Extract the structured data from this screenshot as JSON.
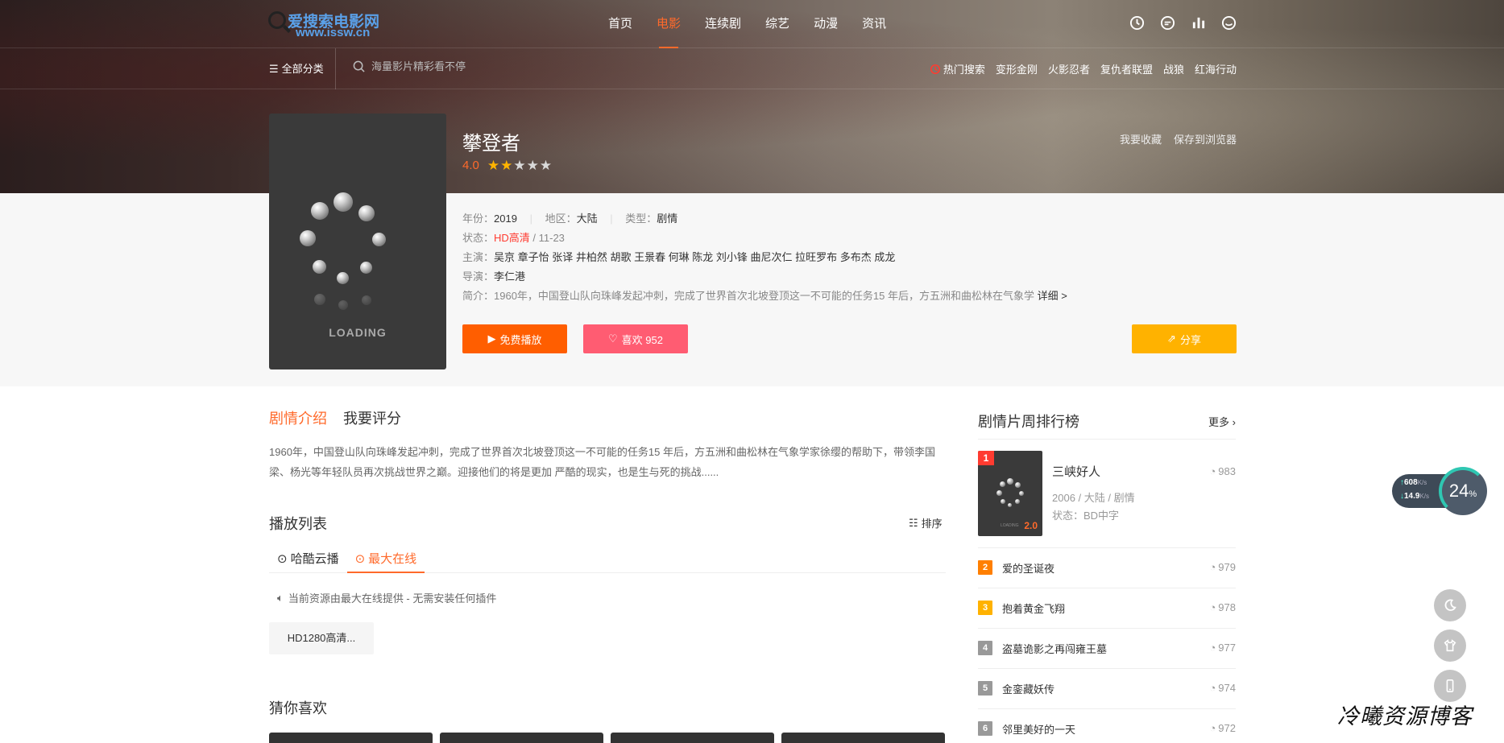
{
  "logo": {
    "line1": "爱搜索电影网",
    "line2": "www.issw.cn"
  },
  "nav": {
    "items": [
      {
        "label": "首页",
        "active": false
      },
      {
        "label": "电影",
        "active": true
      },
      {
        "label": "连续剧",
        "active": false
      },
      {
        "label": "综艺",
        "active": false
      },
      {
        "label": "动漫",
        "active": false
      },
      {
        "label": "资讯",
        "active": false
      }
    ],
    "icons": [
      "clock-icon",
      "message-icon",
      "chart-bar-icon",
      "user-smile-icon"
    ]
  },
  "subnav": {
    "all_categories": "全部分类",
    "search_placeholder": "海量影片精彩看不停",
    "hot_label": "热门搜索",
    "hot_items": [
      "变形金刚",
      "火影忍者",
      "复仇者联盟",
      "战狼",
      "红海行动"
    ]
  },
  "poster": {
    "loading_text": "LOADING"
  },
  "movie": {
    "title": "攀登者",
    "score": "4.0",
    "stars_on": 2,
    "stars_total": 5,
    "links": [
      "我要收藏",
      "保存到浏览器"
    ],
    "year_label": "年份：",
    "year": "2019",
    "region_label": "地区：",
    "region": "大陆",
    "type_label": "类型：",
    "type": "剧情",
    "status_label": "状态：",
    "status_quality": "HD高清",
    "status_date": " / 11-23",
    "cast_label": "主演：",
    "cast": "吴京 章子怡 张译 井柏然 胡歌 王景春 何琳 陈龙 刘小锋 曲尼次仁 拉旺罗布 多布杰 成龙",
    "director_label": "导演：",
    "director": "李仁港",
    "summary_label": "简介：",
    "summary": "1960年，中国登山队向珠峰发起冲刺，完成了世界首次北坡登顶这一不可能的任务15 年后，方五洲和曲松林在气象学",
    "summary_more": "详细 >"
  },
  "buttons": {
    "play": "免费播放",
    "like": "喜欢 952",
    "share": "分享"
  },
  "main": {
    "tabs": [
      {
        "label": "剧情介绍",
        "active": true
      },
      {
        "label": "我要评分",
        "active": false
      }
    ],
    "intro": "1960年，中国登山队向珠峰发起冲刺，完成了世界首次北坡登顶这一不可能的任务15 年后，方五洲和曲松林在气象学家徐缨的帮助下，带领李国梁、杨光等年轻队员再次挑战世界之巅。迎接他们的将是更加 严酷的现实，也是生与死的挑战......",
    "playlist_title": "播放列表",
    "sort_label": "排序",
    "sources": [
      {
        "label": "哈酷云播",
        "active": false
      },
      {
        "label": "最大在线",
        "active": true
      }
    ],
    "notice": "当前资源由最大在线提供 - 无需安装任何插件",
    "episode": "HD1280高清...",
    "guess_title": "猜你喜欢"
  },
  "rank": {
    "title": "剧情片周排行榜",
    "more": "更多",
    "top": {
      "num": "1",
      "name": "三峡好人",
      "score": "2.0",
      "meta": "2006 / 大陆 / 剧情",
      "status": "状态：BD中字",
      "views": "983",
      "loading": "LOADING"
    },
    "items": [
      {
        "num": "2",
        "name": "爱的圣诞夜",
        "views": "979",
        "color": "#ff7f00"
      },
      {
        "num": "3",
        "name": "抱着黄金飞翔",
        "views": "978",
        "color": "#ffb200"
      },
      {
        "num": "4",
        "name": "盗墓诡影之再闯雍王墓",
        "views": "977",
        "color": "#999999"
      },
      {
        "num": "5",
        "name": "金銮藏妖传",
        "views": "974",
        "color": "#999999"
      },
      {
        "num": "6",
        "name": "邻里美好的一天",
        "views": "972",
        "color": "#999999"
      }
    ]
  },
  "widgets": {
    "upload": "608",
    "upload_unit": "K/s",
    "download": "14.9",
    "download_unit": "K/s",
    "cpu": "24",
    "cpu_unit": "%"
  },
  "watermark": "冷曦资源博客",
  "colors": {
    "accent": "#ff6a2b",
    "play": "#ff5e00",
    "like": "#ff5c72",
    "share": "#ffb200",
    "rank1": "#ff3b30"
  }
}
